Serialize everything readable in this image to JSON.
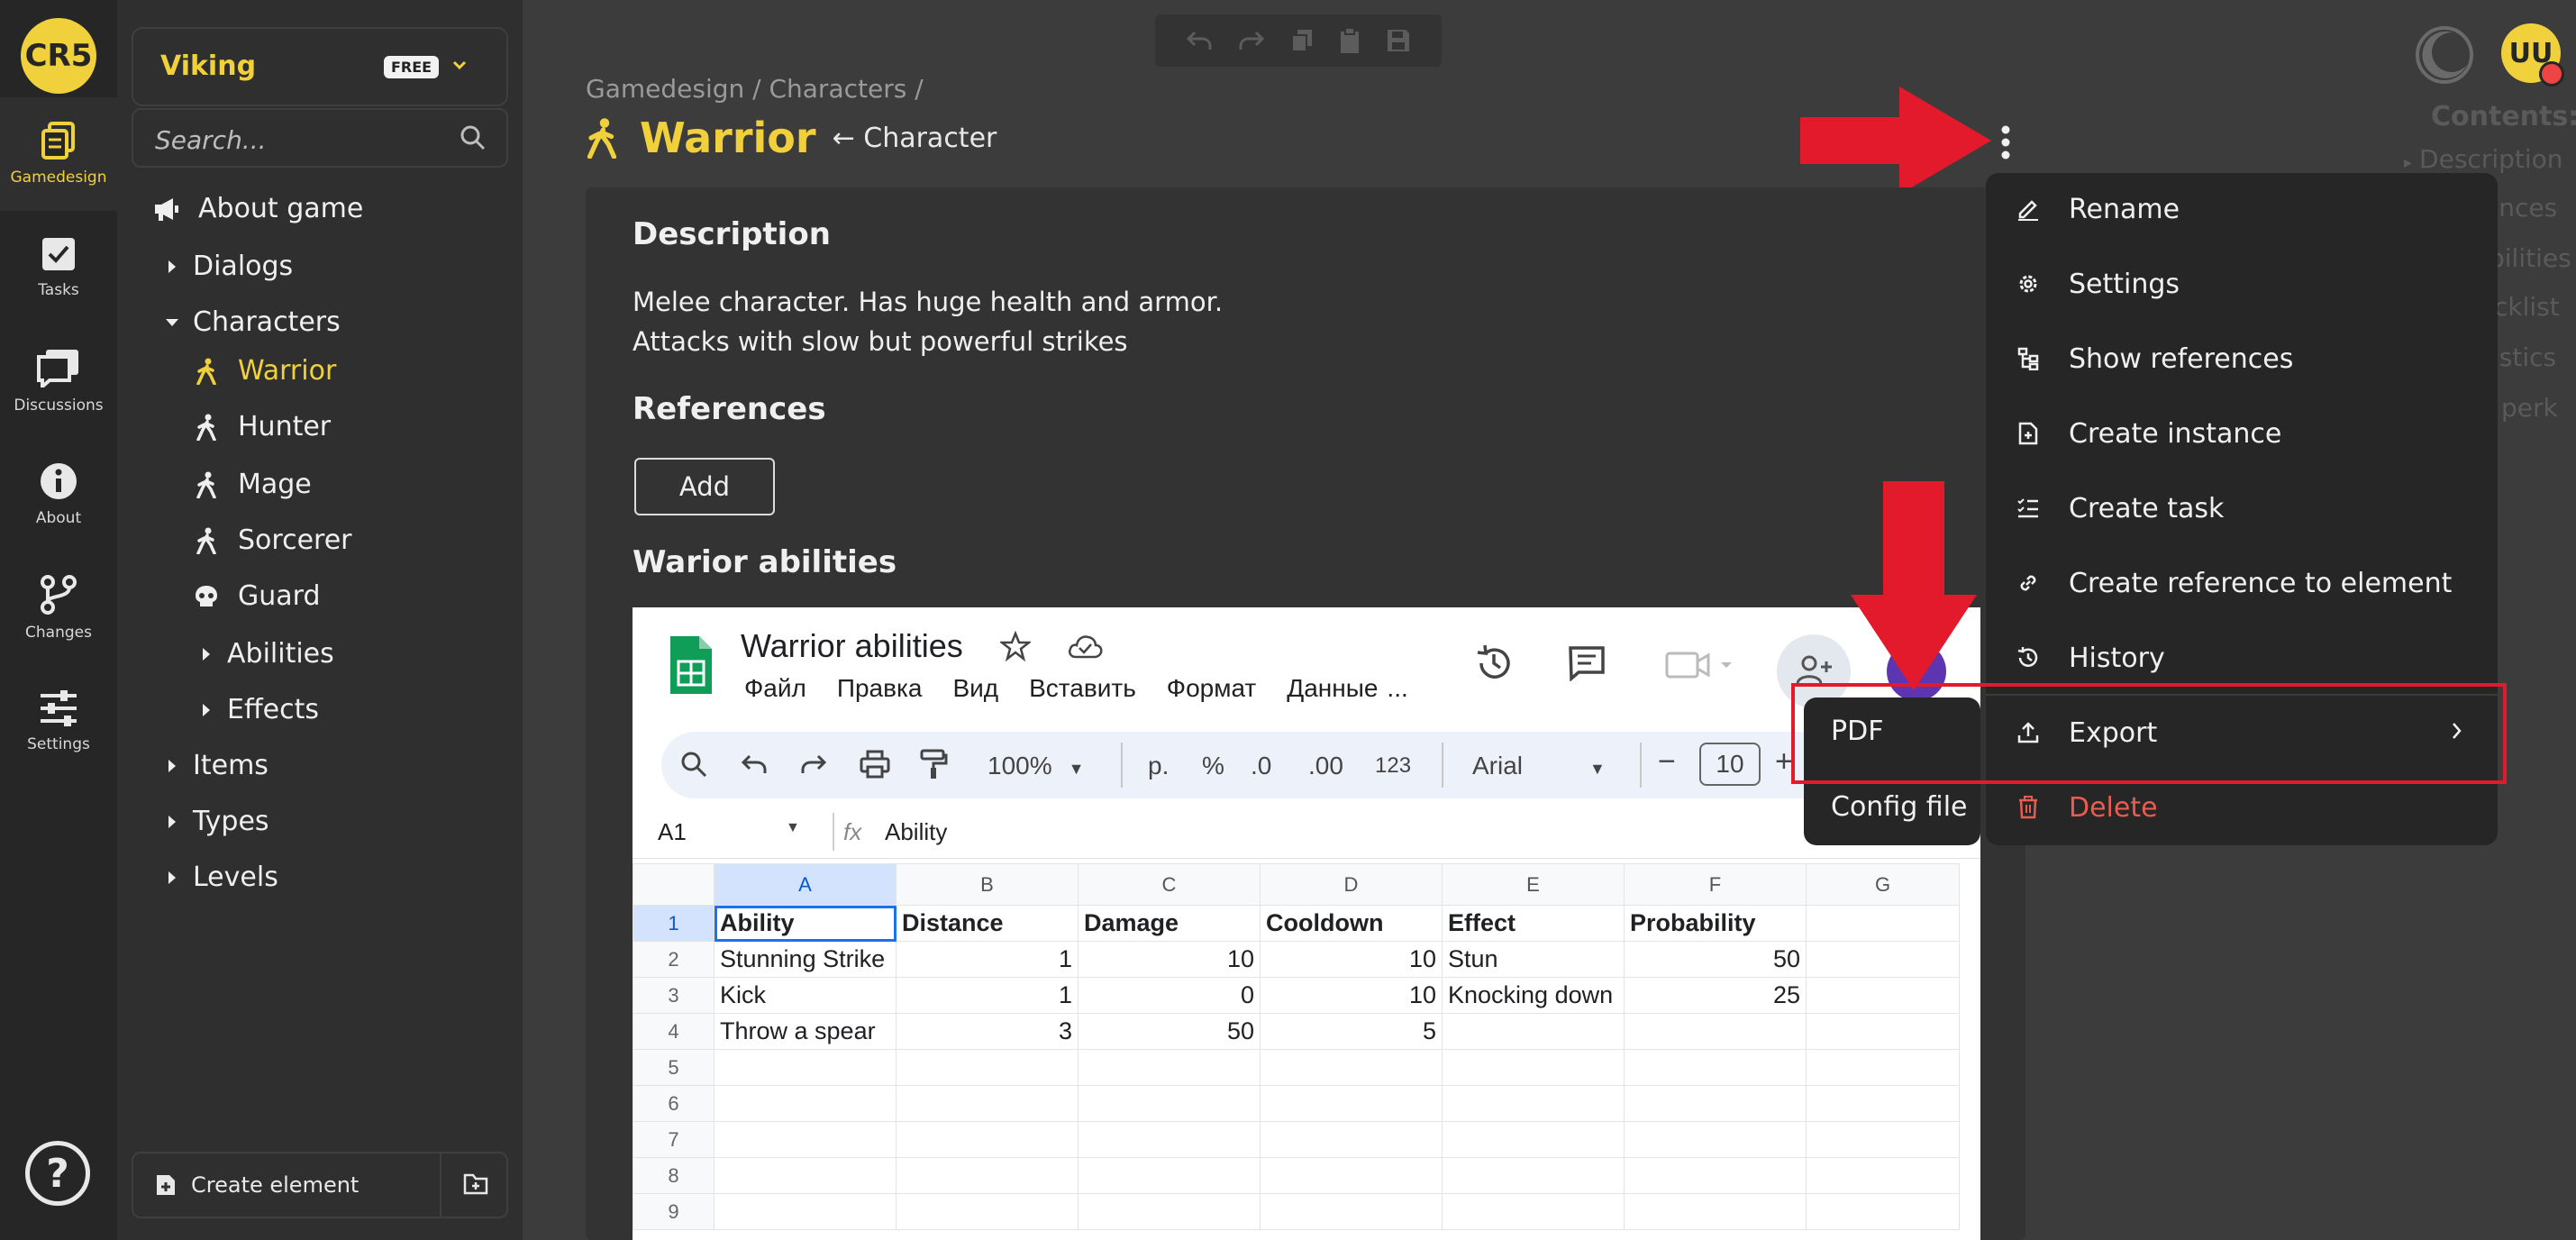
{
  "app": {
    "logo_text": "CR5",
    "accent_color": "#f0d13c"
  },
  "rail": {
    "items": [
      {
        "label": "Gamedesign",
        "icon": "document-stack-icon"
      },
      {
        "label": "Tasks",
        "icon": "checkbox-icon"
      },
      {
        "label": "Discussions",
        "icon": "chat-icon"
      },
      {
        "label": "About",
        "icon": "info-icon"
      },
      {
        "label": "Changes",
        "icon": "branch-icon"
      },
      {
        "label": "Settings",
        "icon": "sliders-icon"
      }
    ],
    "help_label": "?"
  },
  "project": {
    "name": "Viking",
    "plan_badge": "FREE"
  },
  "search": {
    "placeholder": "Search..."
  },
  "tree": {
    "about_game": "About game",
    "dialogs": "Dialogs",
    "characters": "Characters",
    "warrior": "Warrior",
    "hunter": "Hunter",
    "mage": "Mage",
    "sorcerer": "Sorcerer",
    "guard": "Guard",
    "abilities": "Abilities",
    "effects": "Effects",
    "items": "Items",
    "types": "Types",
    "levels": "Levels"
  },
  "create_element_label": "Create element",
  "header": {
    "breadcrumb": "Gamedesign / Characters /",
    "title": "Warrior",
    "type_link": "← Character"
  },
  "user": {
    "avatar_initials": "UU"
  },
  "contents": {
    "title": "Contents:",
    "items": [
      "Description",
      "ences",
      "bilities",
      "cklist",
      "istics",
      "perk"
    ]
  },
  "page": {
    "description_heading": "Description",
    "description_line1": "Melee character. Has huge health and armor.",
    "description_line2": "Attacks with slow but powerful strikes",
    "references_heading": "References",
    "add_button": "Add",
    "abilities_heading": "Warior abilities"
  },
  "sheet": {
    "title": "Warrior abilities",
    "menus": [
      "Файл",
      "Правка",
      "Вид",
      "Вставить",
      "Формат",
      "Данные",
      "..."
    ],
    "zoom": "100%",
    "currency": "р.",
    "percent": "%",
    "dec_minus": ".0",
    "dec_plus": ".00",
    "number_format": "123",
    "font": "Arial",
    "font_size": "10",
    "cell_ref": "A1",
    "formula_value": "Ability",
    "columns": [
      "A",
      "B",
      "C",
      "D",
      "E",
      "F",
      "G"
    ],
    "rows": [
      [
        "Ability",
        "Distance",
        "Damage",
        "Cooldown",
        "Effect",
        "Probability",
        ""
      ],
      [
        "Stunning Strike",
        "1",
        "10",
        "10",
        "Stun",
        "50",
        ""
      ],
      [
        "Kick",
        "1",
        "0",
        "10",
        "Knocking down",
        "25",
        ""
      ],
      [
        "Throw a spear",
        "3",
        "50",
        "5",
        "",
        "",
        ""
      ],
      [
        "",
        "",
        "",
        "",
        "",
        "",
        ""
      ],
      [
        "",
        "",
        "",
        "",
        "",
        "",
        ""
      ],
      [
        "",
        "",
        "",
        "",
        "",
        "",
        ""
      ],
      [
        "",
        "",
        "",
        "",
        "",
        "",
        ""
      ],
      [
        "",
        "",
        "",
        "",
        "",
        "",
        ""
      ]
    ],
    "row_numbers": [
      "1",
      "2",
      "3",
      "4",
      "5",
      "6",
      "7",
      "8",
      "9"
    ]
  },
  "menu": {
    "rename": "Rename",
    "settings": "Settings",
    "show_references": "Show references",
    "create_instance": "Create instance",
    "create_task": "Create task",
    "create_reference": "Create reference to element",
    "history": "History",
    "export": "Export",
    "delete": "Delete"
  },
  "submenu": {
    "pdf": "PDF",
    "config_file": "Config file"
  },
  "annotation_color": "#e21a2b"
}
